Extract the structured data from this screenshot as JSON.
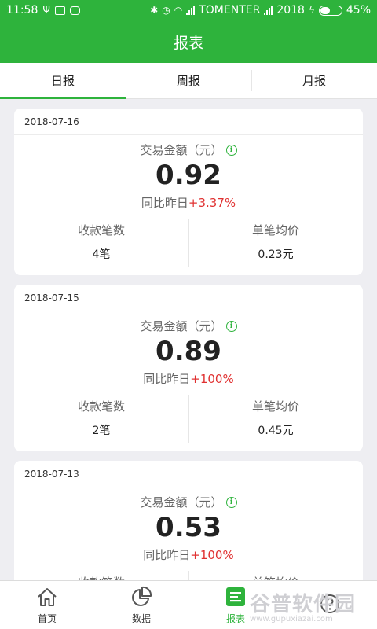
{
  "status_bar": {
    "time": "11:58",
    "carrier": "TOMENTER",
    "carrier2": "2018",
    "battery": "45%",
    "battery_level": 0.45
  },
  "header": {
    "title": "报表"
  },
  "tabs": [
    {
      "label": "日报",
      "active": true
    },
    {
      "label": "周报",
      "active": false
    },
    {
      "label": "月报",
      "active": false
    }
  ],
  "cards": [
    {
      "date": "2018-07-16",
      "amount_label": "交易金额（元）",
      "amount": "0.92",
      "compare_label": "同比昨日",
      "compare_delta": "+3.37%",
      "count_label": "收款笔数",
      "count_value": "4笔",
      "avg_label": "单笔均价",
      "avg_value": "0.23元"
    },
    {
      "date": "2018-07-15",
      "amount_label": "交易金额（元）",
      "amount": "0.89",
      "compare_label": "同比昨日",
      "compare_delta": "+100%",
      "count_label": "收款笔数",
      "count_value": "2笔",
      "avg_label": "单笔均价",
      "avg_value": "0.45元"
    },
    {
      "date": "2018-07-13",
      "amount_label": "交易金额（元）",
      "amount": "0.53",
      "compare_label": "同比昨日",
      "compare_delta": "+100%",
      "count_label": "收款笔数",
      "count_value": "",
      "avg_label": "单笔均价",
      "avg_value": ""
    }
  ],
  "bottom_nav": [
    {
      "label": "首页",
      "icon": "home-icon",
      "active": false
    },
    {
      "label": "数据",
      "icon": "pie-chart-icon",
      "active": false
    },
    {
      "label": "报表",
      "icon": "report-icon",
      "active": true
    },
    {
      "label": "",
      "icon": "help-icon",
      "active": false
    }
  ],
  "watermark": {
    "text": "谷普软件园",
    "url": "www.gupuxiazai.com"
  },
  "colors": {
    "brand": "#2eb33c",
    "delta": "#e03131"
  }
}
